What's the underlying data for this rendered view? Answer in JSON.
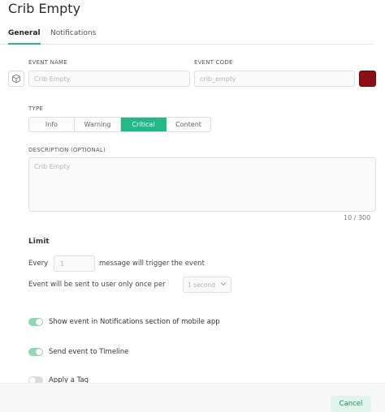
{
  "header": {
    "title": "Crib Empty"
  },
  "tabs": [
    {
      "label": "General",
      "active": true
    },
    {
      "label": "Notifications",
      "active": false
    }
  ],
  "event": {
    "icon": "cube-icon",
    "name_label": "EVENT NAME",
    "name_value": "Crib Empty",
    "code_label": "EVENT CODE",
    "code_value": "crib_empty",
    "color": "#8b0f14"
  },
  "type": {
    "label": "TYPE",
    "options": [
      "Info",
      "Warning",
      "Critical",
      "Content"
    ],
    "selected": "Critical",
    "accent": "#23b887"
  },
  "description": {
    "label": "DESCRIPTION (OPTIONAL)",
    "value": "Crib Empty",
    "counter": "10 / 300"
  },
  "limit": {
    "title": "Limit",
    "every_prefix": "Every",
    "every_value": "1",
    "every_suffix": "message will trigger the event",
    "once_per_label": "Event will be sent to user only once per",
    "once_per_value": "1 second"
  },
  "toggles": [
    {
      "label": "Show event in Notifications section of mobile app",
      "on": true
    },
    {
      "label": "Send event to Timeline",
      "on": true
    },
    {
      "label": "Apply a Tag",
      "on": false
    }
  ],
  "footer": {
    "cancel_label": "Cancel"
  }
}
